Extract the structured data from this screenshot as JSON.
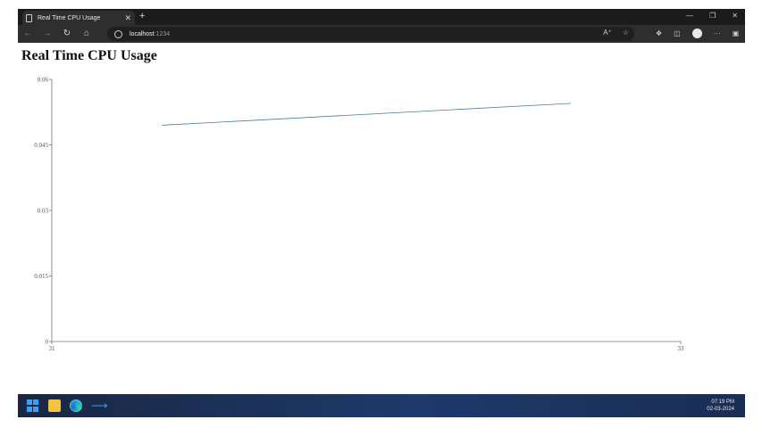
{
  "browser": {
    "tab_title": "Real Time CPU Usage",
    "tab_close": "✕",
    "new_tab": "+",
    "url_host": "localhost",
    "url_port": ":1234",
    "window_controls": [
      "—",
      "❐",
      "✕"
    ]
  },
  "page": {
    "title": "Real Time CPU Usage"
  },
  "chart_data": {
    "type": "line",
    "title": "Real Time CPU Usage",
    "x": [
      31.35,
      32.65
    ],
    "series": [
      {
        "values": [
          0.0495,
          0.0545
        ]
      }
    ],
    "xlim": [
      31,
      33
    ],
    "ylim": [
      0,
      0.06
    ],
    "x_ticks": [
      "31",
      "33"
    ],
    "y_ticks": [
      "0",
      "0.015",
      "0.03",
      "0.045",
      "0.06"
    ],
    "line_color": "#4a7f9a",
    "grid": false
  },
  "taskbar": {
    "time": "07:19 PM",
    "date": "02-03-2024"
  }
}
